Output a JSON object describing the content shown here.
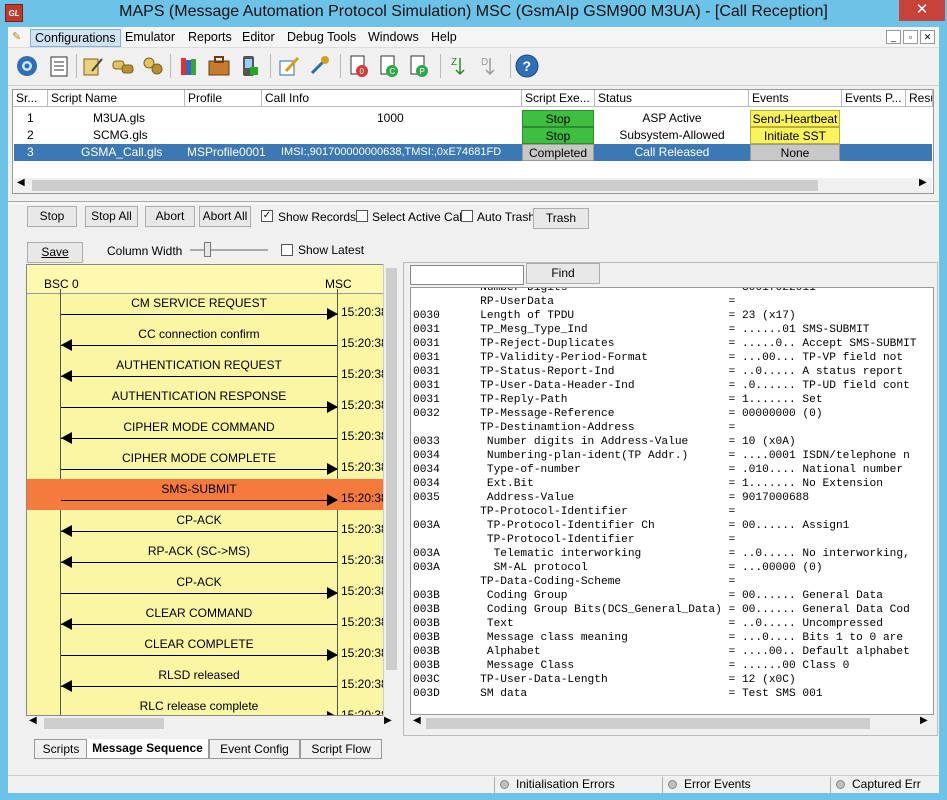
{
  "window": {
    "logo": "GL",
    "title": "MAPS (Message Automation Protocol Simulation) MSC (GsmAIp GSM900 M3UA) - [Call Reception]",
    "close": "✕"
  },
  "menu": [
    "Configurations",
    "Emulator",
    "Reports",
    "Editor",
    "Debug Tools",
    "Windows",
    "Help"
  ],
  "mdi": [
    "_",
    "▫",
    "✕"
  ],
  "grid": {
    "headers": [
      "Sr...",
      "Script Name",
      "Profile",
      "Call Info",
      "Script Exe...",
      "Status",
      "Events",
      "Events P...",
      "Resu"
    ],
    "rows": [
      {
        "sr": "1",
        "script": "M3UA.gls",
        "profile": "",
        "callinfo": "1000",
        "exe": "Stop",
        "status": "ASP Active",
        "events": "Send-Heartbeat"
      },
      {
        "sr": "2",
        "script": "SCMG.gls",
        "profile": "",
        "callinfo": "",
        "exe": "Stop",
        "status": "Subsystem-Allowed",
        "events": "Initiate SST"
      },
      {
        "sr": "3",
        "script": "GSMA_Call.gls",
        "profile": "MSProfile0001",
        "callinfo": "IMSI:,901700000000638,TMSI:,0xE74681FD",
        "exe": "Completed",
        "status": "Call Released",
        "events": "None"
      }
    ]
  },
  "controls": {
    "stop": "Stop",
    "stop_all": "Stop All",
    "abort": "Abort",
    "abort_all": "Abort All",
    "show_records": "Show Records",
    "select_active_call": "Select Active Call",
    "auto_trash": "Auto Trash",
    "trash": "Trash",
    "save": "Save",
    "column_width": "Column Width",
    "show_latest": "Show Latest",
    "find": "Find"
  },
  "sequence": {
    "left_node": "BSC 0",
    "right_node": "MSC",
    "messages": [
      {
        "label": "CM SERVICE REQUEST",
        "dir": "right",
        "time": "15:20:38"
      },
      {
        "label": "CC connection confirm",
        "dir": "left",
        "time": "15:20:38."
      },
      {
        "label": "AUTHENTICATION REQUEST",
        "dir": "left",
        "time": "15:20:38."
      },
      {
        "label": "AUTHENTICATION RESPONSE",
        "dir": "right",
        "time": "15:20:38."
      },
      {
        "label": "CIPHER MODE COMMAND",
        "dir": "left",
        "time": "15:20:38."
      },
      {
        "label": "CIPHER MODE COMPLETE",
        "dir": "right",
        "time": "15:20:38."
      },
      {
        "label": "SMS-SUBMIT",
        "dir": "right",
        "time": "15:20:38.",
        "highlight": true
      },
      {
        "label": "CP-ACK",
        "dir": "left",
        "time": "15:20:38."
      },
      {
        "label": "RP-ACK (SC->MS)",
        "dir": "left",
        "time": "15:20:38."
      },
      {
        "label": "CP-ACK",
        "dir": "right",
        "time": "15:20:38."
      },
      {
        "label": "CLEAR COMMAND",
        "dir": "left",
        "time": "15:20:38."
      },
      {
        "label": "CLEAR COMPLETE",
        "dir": "right",
        "time": "15:20:38."
      },
      {
        "label": "RLSD released",
        "dir": "left",
        "time": "15:20:38."
      },
      {
        "label": "RLC release complete",
        "dir": "right",
        "time": "15:20:38"
      }
    ]
  },
  "decode": [
    [
      "",
      "Number Digits",
      "",
      "30017022011"
    ],
    [
      "",
      "RP-UserData",
      "",
      ""
    ],
    [
      "0030",
      "Length of TPDU",
      "",
      "23 (x17)"
    ],
    [
      "0031",
      "TP_Mesg_Type_Ind",
      "",
      "......01 SMS-SUBMIT"
    ],
    [
      "0031",
      "TP-Reject-Duplicates",
      "",
      ".....0.. Accept SMS-SUBMIT"
    ],
    [
      "0031",
      "TP-Validity-Period-Format",
      "",
      "...00... TP-VP field not"
    ],
    [
      "0031",
      "TP-Status-Report-Ind",
      "",
      "..0..... A status report"
    ],
    [
      "0031",
      "TP-User-Data-Header-Ind",
      "",
      ".0...... TP-UD field cont"
    ],
    [
      "0031",
      "TP-Reply-Path",
      "",
      "1....... Set"
    ],
    [
      "0032",
      "TP-Message-Reference",
      "",
      "00000000 (0)"
    ],
    [
      "",
      "TP-Destinamtion-Address",
      "",
      ""
    ],
    [
      "0033",
      "Number digits in Address-Value",
      "",
      "10 (x0A)"
    ],
    [
      "0034",
      "Numbering-plan-ident(TP Addr.)",
      "",
      "....0001 ISDN/telephone n"
    ],
    [
      "0034",
      "Type-of-number",
      "",
      ".010.... National number"
    ],
    [
      "0034",
      "Ext.Bit",
      "",
      "1....... No Extension"
    ],
    [
      "0035",
      "Address-Value",
      "",
      "9017000688"
    ],
    [
      "",
      "TP-Protocol-Identifier",
      "",
      ""
    ],
    [
      "003A",
      "TP-Protocol-Identifier Ch",
      "",
      "00...... Assign1"
    ],
    [
      "",
      "TP-Protocol-Identifier",
      "",
      ""
    ],
    [
      "003A",
      "Telematic interworking",
      "",
      "..0..... No interworking,"
    ],
    [
      "003A",
      "SM-AL protocol",
      "",
      "...00000 (0)"
    ],
    [
      "",
      "TP-Data-Coding-Scheme",
      "",
      ""
    ],
    [
      "003B",
      "Coding Group",
      "",
      "00...... General Data"
    ],
    [
      "003B",
      "Coding Group Bits(DCS_General_Data)",
      "",
      "00...... General Data Cod"
    ],
    [
      "003B",
      "Text",
      "",
      "..0..... Uncompressed"
    ],
    [
      "003B",
      "Message class meaning",
      "",
      "...0.... Bits 1 to 0 are"
    ],
    [
      "003B",
      "Alphabet",
      "",
      "....00.. Default alphabet"
    ],
    [
      "003B",
      "Message Class",
      "",
      "......00 Class 0"
    ],
    [
      "003C",
      "TP-User-Data-Length",
      "",
      "12 (x0C)"
    ],
    [
      "003D",
      "SM data",
      "",
      "Test SMS 001"
    ]
  ],
  "tabs": [
    "Scripts",
    "Message Sequence",
    "Event Config",
    "Script Flow"
  ],
  "statusbar": [
    "Initialisation Errors",
    "Error Events",
    "Captured Err"
  ]
}
